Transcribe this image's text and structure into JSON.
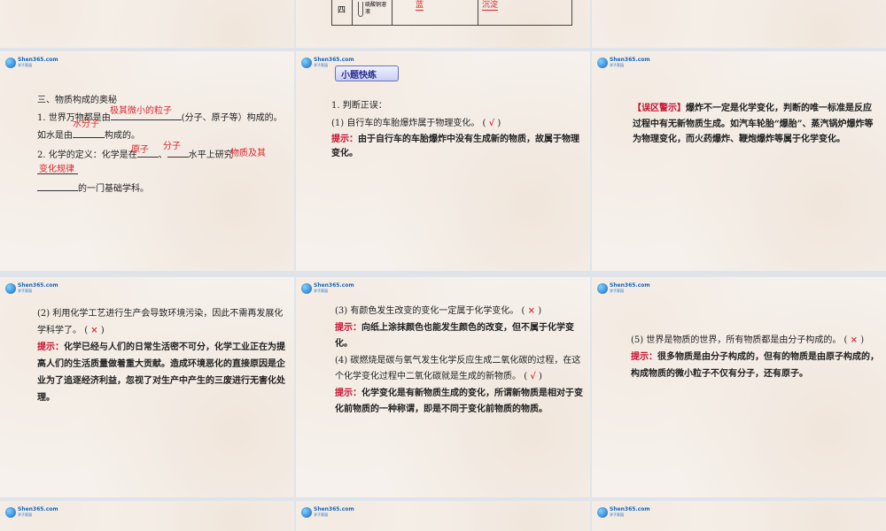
{
  "logo": {
    "line1": "Shen365.com",
    "line2": "学子家园"
  },
  "top_slide": {
    "row_label": "四",
    "reagent": "硫酸铜溶液",
    "col2": "蓝",
    "col3": "沉淀"
  },
  "slide_a": {
    "heading": "三、物质构成的奥秘",
    "q1_pre": "1. 世界万物都是由",
    "q1_ans": "极其微小的粒子",
    "q1_post": "(分子、原子等）构成的。",
    "q1_line2_pre": "如水是由",
    "q1_line2_ans": "水分子",
    "q1_line2_post": "构成的。",
    "q2_pre": "2. 化学的定义：化学是在",
    "q2_ans1": "原子",
    "q2_sep": "、",
    "q2_ans2": "分子",
    "q2_mid": "水平上研究",
    "q2_ans3": "物质及其",
    "q2_ans4": "变化规律",
    "q2_post": "的一门基础学科。"
  },
  "slide_b": {
    "badge": "小题快练",
    "item1": "1. 判断正误：",
    "item2": "(1) 自行车的车胎爆炸属于物理变化。",
    "mark": "√",
    "hint_label": "提示：",
    "hint": "由于自行车的车胎爆炸中没有生成新的物质，故属于物理变化。"
  },
  "slide_c": {
    "label": "【误区警示】",
    "text": "爆炸不一定是化学变化，判断的唯一标准是反应过程中有无新物质生成。如汽车轮胎“爆胎”、蒸汽锅炉爆炸等为物理变化，而火药爆炸、鞭炮爆炸等属于化学变化。"
  },
  "slide_d": {
    "q": "(2) 利用化学工艺进行生产会导致环境污染，因此不需再发展化学科学了。",
    "mark": "×",
    "hint_label": "提示：",
    "hint": "化学已经与人们的日常生活密不可分，化学工业正在为提高人们的生活质量做着重大贡献。造成环境恶化的直接原因是企业为了追逐经济利益，忽视了对生产中产生的三废进行无害化处理。"
  },
  "slide_e": {
    "q3": "(3) 有颜色发生改变的变化一定属于化学变化。",
    "mark3": "×",
    "hint_label": "提示：",
    "hint3": "向纸上涂抹颜色也能发生颜色的改变，但不属于化学变化。",
    "q4": "(4) 碳燃烧是碳与氧气发生化学反应生成二氧化碳的过程，在这个化学变化过程中二氧化碳就是生成的新物质。",
    "mark4": "√",
    "hint4": "化学变化是有新物质生成的变化，所谓新物质是相对于变化前物质的一种称谓，即是不同于变化前物质的物质。"
  },
  "slide_f": {
    "q5": "(5) 世界是物质的世界，所有物质都是由分子构成的。",
    "mark5": "×",
    "hint_label": "提示：",
    "hint5": "很多物质是由分子构成的，但有的物质是由原子构成的，构成物质的微小粒子不仅有分子，还有原子。"
  }
}
